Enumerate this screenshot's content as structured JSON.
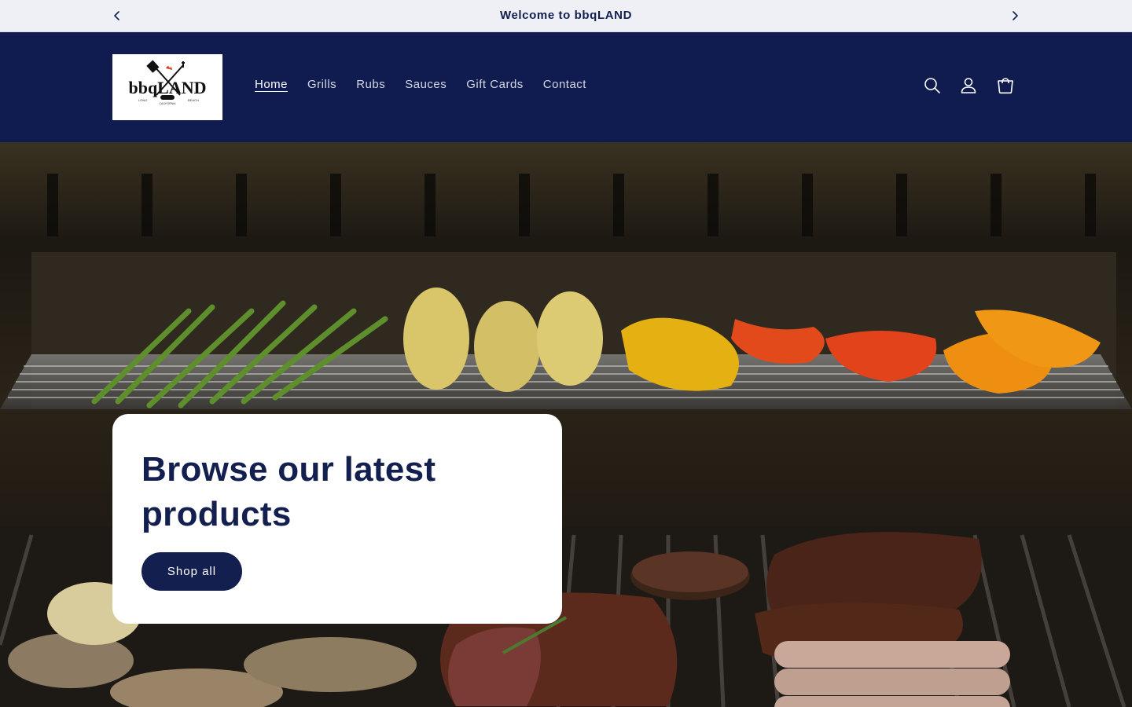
{
  "announcement": {
    "message": "Welcome to bbqLAND",
    "prev_icon": "chevron-left-icon",
    "next_icon": "chevron-right-icon"
  },
  "header": {
    "logo": {
      "wordmark": "bbqLAND",
      "subtext_left": "LONG",
      "subtext_right": "BEACH",
      "subtext_bottom": "CALIFORNIA"
    },
    "nav": [
      {
        "label": "Home",
        "active": true
      },
      {
        "label": "Grills",
        "active": false
      },
      {
        "label": "Rubs",
        "active": false
      },
      {
        "label": "Sauces",
        "active": false
      },
      {
        "label": "Gift Cards",
        "active": false
      },
      {
        "label": "Contact",
        "active": false
      }
    ],
    "icons": [
      "search-icon",
      "account-icon",
      "cart-icon"
    ]
  },
  "hero": {
    "heading": "Browse our latest products",
    "button_label": "Shop all"
  },
  "colors": {
    "brand_navy": "#101c50",
    "text_navy": "#121f4f",
    "announce_bg": "#eff0f5"
  }
}
